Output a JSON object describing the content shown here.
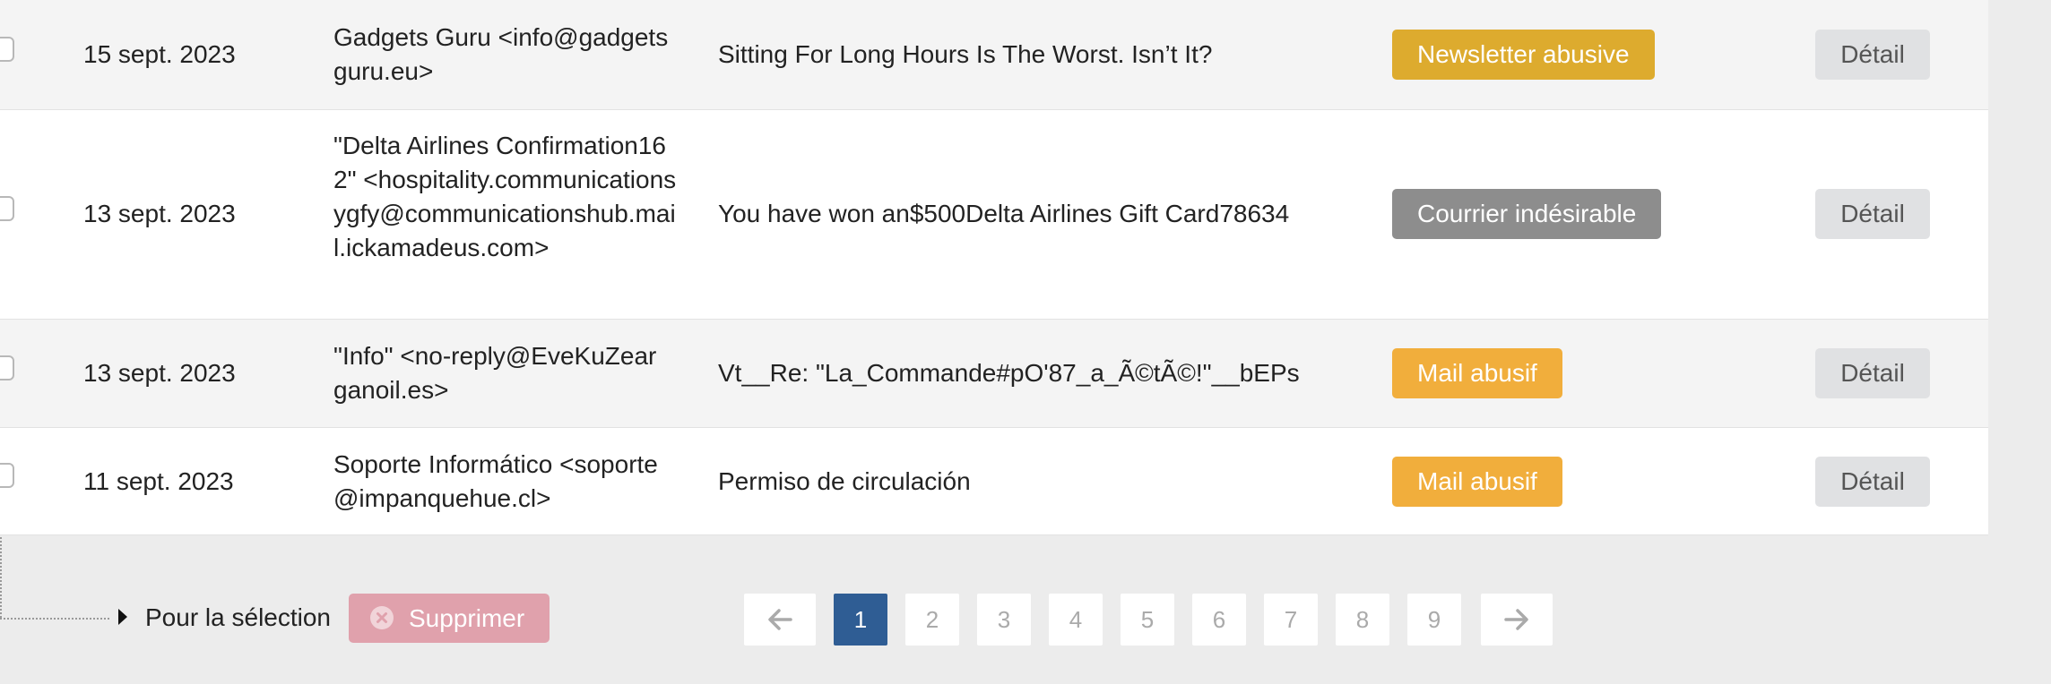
{
  "rows": [
    {
      "date": "15 sept. 2023",
      "from": "Gadgets Guru <info@gadgetsguru.eu>",
      "subject": "Sitting For Long Hours Is The Worst. Isn’t It?",
      "badge": "Newsletter abusive",
      "badge_color": "#ddab2e",
      "detail": "Détail"
    },
    {
      "date": "13 sept. 2023",
      "from": "\"Delta Airlines Confirmation162\" <hospitality.communicationsygfy@communicationshub.mail.ickamadeus.com>",
      "subject": "You have won an$500Delta Airlines Gift Card78634",
      "badge": "Courrier indésirable",
      "badge_color": "#8d8d8d",
      "detail": "Détail"
    },
    {
      "date": "13 sept. 2023",
      "from": "\"Info\" <no-reply@EveKuZearganoil.es>",
      "subject": "Vt__Re: \"La_Commande#pO'87_a_Ã©tÃ©!\"__bEPs",
      "badge": "Mail abusif",
      "badge_color": "#f1ae3c",
      "detail": "Détail"
    },
    {
      "date": "11 sept. 2023",
      "from": "Soporte Informático <soporte@impanquehue.cl>",
      "subject": "Permiso de circulación",
      "badge": "Mail abusif",
      "badge_color": "#f1ae3c",
      "detail": "Détail"
    }
  ],
  "selection": {
    "label": "Pour la sélection",
    "delete_label": "Supprimer",
    "delete_icon": "x-circle-icon"
  },
  "pagination": {
    "prev_icon": "arrow-left-icon",
    "next_icon": "arrow-right-icon",
    "pages": [
      "1",
      "2",
      "3",
      "4",
      "5",
      "6",
      "7",
      "8",
      "9"
    ],
    "current_page": "1",
    "active_color": "#2f5d94"
  }
}
